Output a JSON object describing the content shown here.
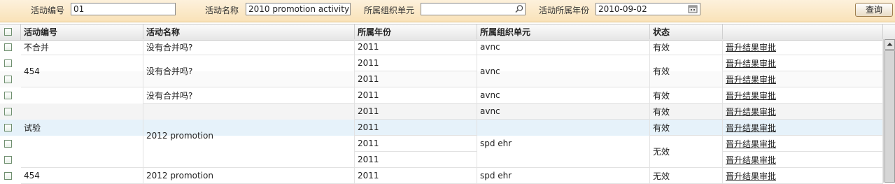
{
  "filters": {
    "activity_code_label": "活动编号",
    "activity_code_value": "01",
    "activity_name_label": "活动名称",
    "activity_name_value": "2010 promotion activity",
    "org_unit_label": "所属组织单元",
    "org_unit_value": "",
    "year_label": "活动所属年份",
    "year_value": "2010-09-02",
    "query_button": "查询"
  },
  "table": {
    "headers": [
      "活动编号",
      "活动名称",
      "所属年份",
      "所属组织单元",
      "状态",
      ""
    ],
    "link_label": "晋升结果审批",
    "cells": {
      "r0_code": "不合并",
      "r0_name": "没有合并吗?",
      "r0_year": "2011",
      "r0_org": "avnc",
      "r0_status": "有效",
      "g1_code": "454",
      "g1_name": "没有合并吗?",
      "r1_year": "2011",
      "r2_year": "2011",
      "g1_org": "avnc",
      "g1_status": "有效",
      "g3_code": "试验",
      "r3_name": "没有合并吗?",
      "r3_year": "2011",
      "r3_org": "avnc",
      "r3_status": "有效",
      "g4_name": "2012 promotion",
      "r4_year": "2011",
      "r4_org": "avnc",
      "r4_status": "有效",
      "r5_year": "2011",
      "g5_org": "spd ehr",
      "r5_status": "有效",
      "r6_year": "2011",
      "r7_year": "2011",
      "g6_status": "无效",
      "r8_code": "454",
      "r8_name": "2012 promotion",
      "r8_year": "2011",
      "r8_org": "spd ehr",
      "r8_status": "无效"
    }
  },
  "colors": {
    "filter_bg": "#f9e2b8",
    "selected_row": "#e6f2fa",
    "alt_row": "#f5f5f5"
  }
}
